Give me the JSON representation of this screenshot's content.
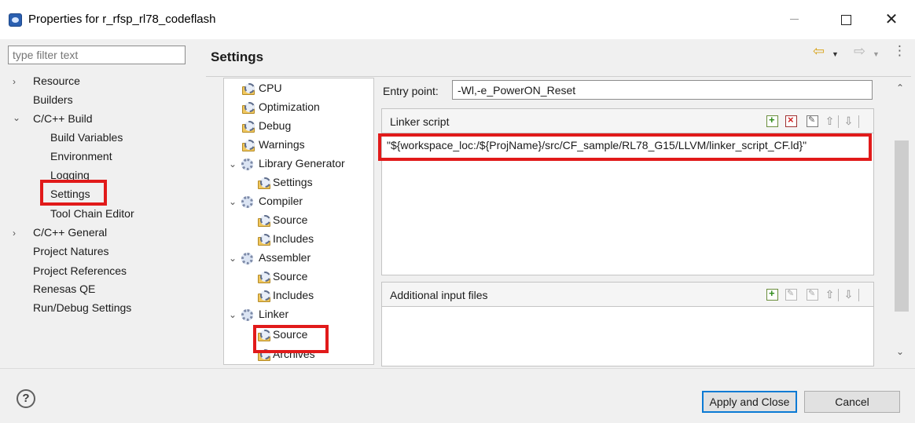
{
  "window": {
    "title": "Properties for r_rfsp_rl78_codeflash",
    "minimize_icon": "minimize-icon",
    "maximize_icon": "maximize-icon",
    "close_glyph": "✕"
  },
  "filter": {
    "placeholder": "type filter text"
  },
  "nav": {
    "items": [
      {
        "label": "Resource",
        "expander": "›"
      },
      {
        "label": "Builders"
      },
      {
        "label": "C/C++ Build",
        "expander": "⌄"
      },
      {
        "label": "Build Variables"
      },
      {
        "label": "Environment"
      },
      {
        "label": "Logging"
      },
      {
        "label": "Settings",
        "selected": true
      },
      {
        "label": "Tool Chain Editor"
      },
      {
        "label": "C/C++ General",
        "expander": "›"
      },
      {
        "label": "Project Natures"
      },
      {
        "label": "Project References"
      },
      {
        "label": "Renesas QE"
      },
      {
        "label": "Run/Debug Settings"
      }
    ]
  },
  "page": {
    "title": "Settings",
    "back_glyph": "⇦",
    "forward_glyph": "⇨",
    "menu_glyph": "⋮",
    "dropdown_glyph": "▼"
  },
  "tool_tree": {
    "items": [
      {
        "label": "CPU"
      },
      {
        "label": "Optimization"
      },
      {
        "label": "Debug"
      },
      {
        "label": "Warnings"
      },
      {
        "label": "Library Generator",
        "expander": "⌄"
      },
      {
        "label": "Settings"
      },
      {
        "label": "Compiler",
        "expander": "⌄"
      },
      {
        "label": "Source"
      },
      {
        "label": "Includes"
      },
      {
        "label": "Assembler",
        "expander": "⌄"
      },
      {
        "label": "Source"
      },
      {
        "label": "Includes"
      },
      {
        "label": "Linker",
        "expander": "⌄"
      },
      {
        "label": "Source",
        "selected": true
      },
      {
        "label": "Archives"
      }
    ]
  },
  "entry_point": {
    "label": "Entry point:",
    "value": "-Wl,-e_PowerON_Reset"
  },
  "linker_script": {
    "header": "Linker script",
    "items": [
      "\"${workspace_loc:/${ProjName}/src/CF_sample/RL78_G15/LLVM/linker_script_CF.ld}\""
    ]
  },
  "additional_input_files": {
    "header": "Additional input files",
    "items": []
  },
  "toolbar_icons": [
    "add-icon",
    "delete-icon",
    "edit-icon",
    "move-up-icon",
    "move-down-icon"
  ],
  "scroll": {
    "up_glyph": "⌃",
    "down_glyph": "⌄"
  },
  "footer": {
    "help_glyph": "?",
    "apply_label": "Apply and Close",
    "cancel_label": "Cancel"
  },
  "colors": {
    "highlight": "#e11a1a",
    "default_button_border": "#0a7ad4"
  }
}
